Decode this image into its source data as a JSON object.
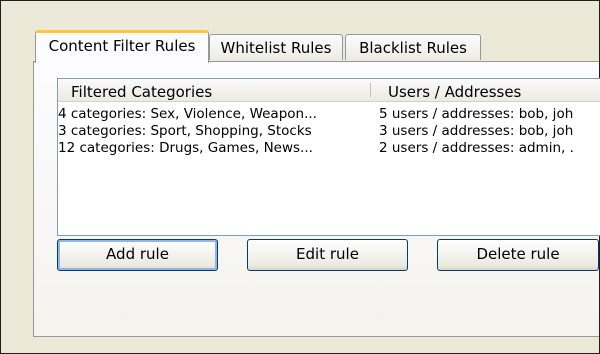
{
  "tabs": [
    {
      "label": "Content Filter Rules",
      "active": true
    },
    {
      "label": "Whitelist Rules",
      "active": false
    },
    {
      "label": "Blacklist Rules",
      "active": false
    }
  ],
  "list": {
    "columns": [
      "Filtered Categories",
      "Users / Addresses"
    ],
    "rows": [
      [
        "4 categories: Sex, Violence, Weapon...",
        "5 users / addresses: bob, joh"
      ],
      [
        "3 categories: Sport, Shopping, Stocks",
        "3 users / addresses: bob, joh"
      ],
      [
        "12 categories: Drugs, Games, News...",
        "2 users / addresses: admin, ."
      ]
    ]
  },
  "buttons": {
    "add": "Add rule",
    "edit": "Edit rule",
    "delete": "Delete rule"
  },
  "colors": {
    "active_tab_highlight": "#ffc83c",
    "dialog_background": "#ece9d8",
    "default_button_focus": "#92b5e8"
  }
}
